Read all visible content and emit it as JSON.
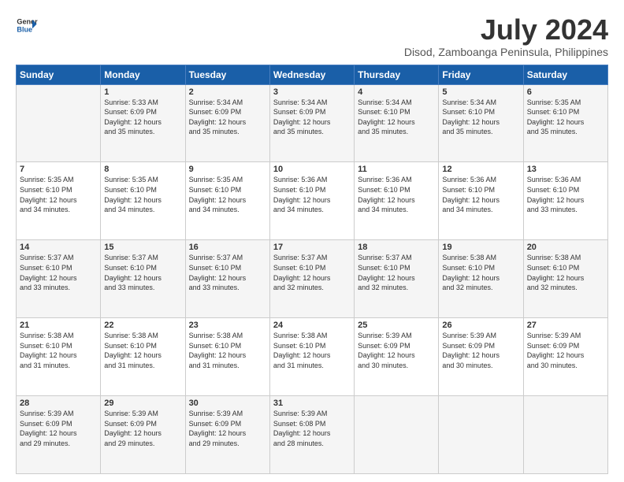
{
  "logo": {
    "line1": "General",
    "line2": "Blue",
    "icon_color": "#1a5fa8"
  },
  "title": "July 2024",
  "subtitle": "Disod, Zamboanga Peninsula, Philippines",
  "days_of_week": [
    "Sunday",
    "Monday",
    "Tuesday",
    "Wednesday",
    "Thursday",
    "Friday",
    "Saturday"
  ],
  "weeks": [
    [
      {
        "day": "",
        "info": ""
      },
      {
        "day": "1",
        "info": "Sunrise: 5:33 AM\nSunset: 6:09 PM\nDaylight: 12 hours\nand 35 minutes."
      },
      {
        "day": "2",
        "info": "Sunrise: 5:34 AM\nSunset: 6:09 PM\nDaylight: 12 hours\nand 35 minutes."
      },
      {
        "day": "3",
        "info": "Sunrise: 5:34 AM\nSunset: 6:09 PM\nDaylight: 12 hours\nand 35 minutes."
      },
      {
        "day": "4",
        "info": "Sunrise: 5:34 AM\nSunset: 6:10 PM\nDaylight: 12 hours\nand 35 minutes."
      },
      {
        "day": "5",
        "info": "Sunrise: 5:34 AM\nSunset: 6:10 PM\nDaylight: 12 hours\nand 35 minutes."
      },
      {
        "day": "6",
        "info": "Sunrise: 5:35 AM\nSunset: 6:10 PM\nDaylight: 12 hours\nand 35 minutes."
      }
    ],
    [
      {
        "day": "7",
        "info": "Sunrise: 5:35 AM\nSunset: 6:10 PM\nDaylight: 12 hours\nand 34 minutes."
      },
      {
        "day": "8",
        "info": "Sunrise: 5:35 AM\nSunset: 6:10 PM\nDaylight: 12 hours\nand 34 minutes."
      },
      {
        "day": "9",
        "info": "Sunrise: 5:35 AM\nSunset: 6:10 PM\nDaylight: 12 hours\nand 34 minutes."
      },
      {
        "day": "10",
        "info": "Sunrise: 5:36 AM\nSunset: 6:10 PM\nDaylight: 12 hours\nand 34 minutes."
      },
      {
        "day": "11",
        "info": "Sunrise: 5:36 AM\nSunset: 6:10 PM\nDaylight: 12 hours\nand 34 minutes."
      },
      {
        "day": "12",
        "info": "Sunrise: 5:36 AM\nSunset: 6:10 PM\nDaylight: 12 hours\nand 34 minutes."
      },
      {
        "day": "13",
        "info": "Sunrise: 5:36 AM\nSunset: 6:10 PM\nDaylight: 12 hours\nand 33 minutes."
      }
    ],
    [
      {
        "day": "14",
        "info": "Sunrise: 5:37 AM\nSunset: 6:10 PM\nDaylight: 12 hours\nand 33 minutes."
      },
      {
        "day": "15",
        "info": "Sunrise: 5:37 AM\nSunset: 6:10 PM\nDaylight: 12 hours\nand 33 minutes."
      },
      {
        "day": "16",
        "info": "Sunrise: 5:37 AM\nSunset: 6:10 PM\nDaylight: 12 hours\nand 33 minutes."
      },
      {
        "day": "17",
        "info": "Sunrise: 5:37 AM\nSunset: 6:10 PM\nDaylight: 12 hours\nand 32 minutes."
      },
      {
        "day": "18",
        "info": "Sunrise: 5:37 AM\nSunset: 6:10 PM\nDaylight: 12 hours\nand 32 minutes."
      },
      {
        "day": "19",
        "info": "Sunrise: 5:38 AM\nSunset: 6:10 PM\nDaylight: 12 hours\nand 32 minutes."
      },
      {
        "day": "20",
        "info": "Sunrise: 5:38 AM\nSunset: 6:10 PM\nDaylight: 12 hours\nand 32 minutes."
      }
    ],
    [
      {
        "day": "21",
        "info": "Sunrise: 5:38 AM\nSunset: 6:10 PM\nDaylight: 12 hours\nand 31 minutes."
      },
      {
        "day": "22",
        "info": "Sunrise: 5:38 AM\nSunset: 6:10 PM\nDaylight: 12 hours\nand 31 minutes."
      },
      {
        "day": "23",
        "info": "Sunrise: 5:38 AM\nSunset: 6:10 PM\nDaylight: 12 hours\nand 31 minutes."
      },
      {
        "day": "24",
        "info": "Sunrise: 5:38 AM\nSunset: 6:10 PM\nDaylight: 12 hours\nand 31 minutes."
      },
      {
        "day": "25",
        "info": "Sunrise: 5:39 AM\nSunset: 6:09 PM\nDaylight: 12 hours\nand 30 minutes."
      },
      {
        "day": "26",
        "info": "Sunrise: 5:39 AM\nSunset: 6:09 PM\nDaylight: 12 hours\nand 30 minutes."
      },
      {
        "day": "27",
        "info": "Sunrise: 5:39 AM\nSunset: 6:09 PM\nDaylight: 12 hours\nand 30 minutes."
      }
    ],
    [
      {
        "day": "28",
        "info": "Sunrise: 5:39 AM\nSunset: 6:09 PM\nDaylight: 12 hours\nand 29 minutes."
      },
      {
        "day": "29",
        "info": "Sunrise: 5:39 AM\nSunset: 6:09 PM\nDaylight: 12 hours\nand 29 minutes."
      },
      {
        "day": "30",
        "info": "Sunrise: 5:39 AM\nSunset: 6:09 PM\nDaylight: 12 hours\nand 29 minutes."
      },
      {
        "day": "31",
        "info": "Sunrise: 5:39 AM\nSunset: 6:08 PM\nDaylight: 12 hours\nand 28 minutes."
      },
      {
        "day": "",
        "info": ""
      },
      {
        "day": "",
        "info": ""
      },
      {
        "day": "",
        "info": ""
      }
    ]
  ]
}
